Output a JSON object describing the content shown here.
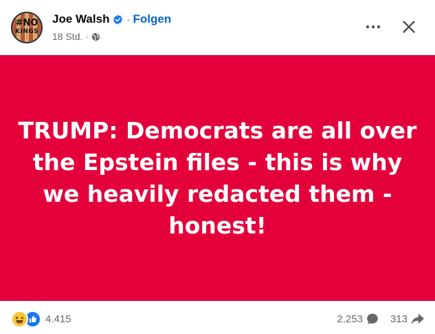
{
  "post": {
    "author": "Joe Walsh",
    "follow_label": "Folgen",
    "separator": "·",
    "time": "18 Std.",
    "avatar_text_line1": "#NO",
    "avatar_text_line2": "KINGS",
    "privacy_icon": "globe-icon",
    "verified_icon": "verified-badge-icon"
  },
  "toolbar": {
    "more_icon": "more-options-icon",
    "close_icon": "close-icon"
  },
  "banner": {
    "background": "#e4003a",
    "text": "TRUMP: Democrats are all over the Epstein files - this is why we heavily redacted them - honest!"
  },
  "footer": {
    "reaction_icons": [
      "haha-reaction-icon",
      "like-reaction-icon"
    ],
    "reaction_count": "4.415",
    "comment_count": "2.253",
    "comment_icon": "comment-icon",
    "share_count": "313",
    "share_icon": "share-icon"
  },
  "colors": {
    "accent": "#0064d1",
    "verified": "#1877f2",
    "muted": "#65676b",
    "banner": "#e4003a"
  }
}
